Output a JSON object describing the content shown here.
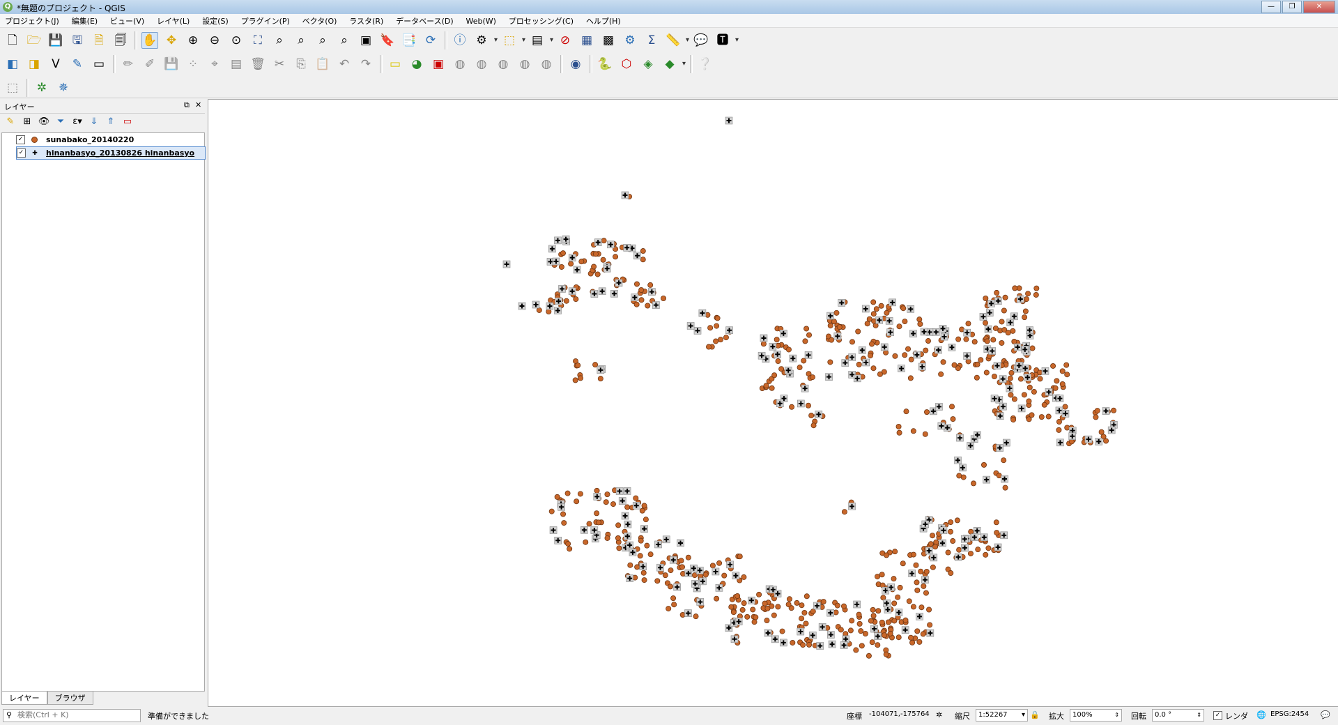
{
  "window": {
    "title": "*無題のプロジェクト - QGIS",
    "buttons": {
      "minimize": "—",
      "maximize": "❐",
      "close": "✕"
    }
  },
  "menu": [
    "プロジェクト(J)",
    "編集(E)",
    "ビュー(V)",
    "レイヤ(L)",
    "設定(S)",
    "プラグイン(P)",
    "ベクタ(O)",
    "ラスタ(R)",
    "データベース(D)",
    "Web(W)",
    "プロセッシング(C)",
    "ヘルプ(H)"
  ],
  "layers_panel": {
    "title": "レイヤー",
    "layers": [
      {
        "name": "sunabako_20140220",
        "checked": true,
        "symbol": "circle",
        "color": "#c8672a"
      },
      {
        "name": "hinanbasyo_20130826 hinanbasyo",
        "checked": true,
        "symbol": "cross-box",
        "selected": true
      }
    ],
    "tabs": [
      "レイヤー",
      "ブラウザ"
    ]
  },
  "statusbar": {
    "search_placeholder": "検索(Ctrl + K)",
    "message": "準備ができました",
    "coord_label": "座標",
    "coord_value": "-104071,-175764",
    "scale_label": "縮尺",
    "scale_value": "1:52267",
    "magnify_label": "拡大",
    "magnify_value": "100%",
    "rotation_label": "回転",
    "rotation_value": "0.0 °",
    "render_label": "レンダ",
    "render_checked": true,
    "crs": "EPSG:2454"
  },
  "colors": {
    "point_fill": "#c8672a",
    "point_stroke": "#6e3613",
    "cross_box": "#cfcfcf",
    "accent": "#3b6fb6"
  }
}
